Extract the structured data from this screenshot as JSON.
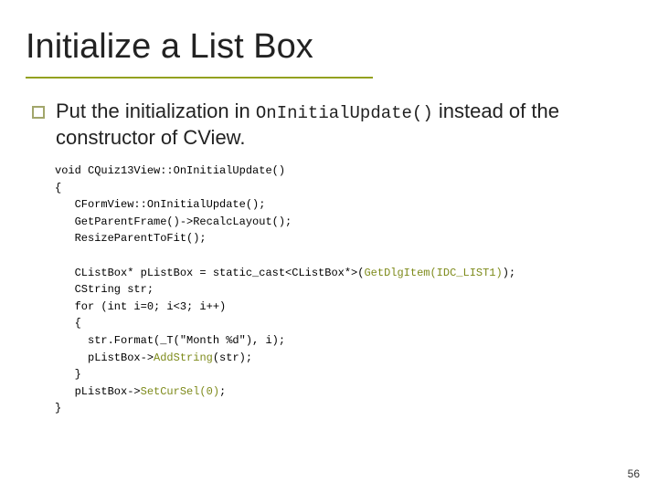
{
  "title": "Initialize a List Box",
  "bullet": {
    "lead": "Put the initialization in ",
    "mono": "OnInitialUpdate()",
    "tail": " instead of the constructor of CView."
  },
  "code": {
    "l1": "void CQuiz13View::OnInitialUpdate()",
    "l2": "{",
    "l3": "   CFormView::OnInitialUpdate();",
    "l4": "   GetParentFrame()->RecalcLayout();",
    "l5": "   ResizeParentToFit();",
    "l6": "",
    "l7a": "   CListBox* pListBox = static_cast<CListBox*>(",
    "l7b": "GetDlgItem(IDC_LIST1)",
    "l7c": ");",
    "l8": "   CString str;",
    "l9": "   for (int i=0; i<3; i++)",
    "l10": "   {",
    "l11": "     str.Format(_T(\"Month %d\"), i);",
    "l12a": "     pListBox->",
    "l12b": "AddString",
    "l12c": "(str);",
    "l13": "   }",
    "l14a": "   pListBox->",
    "l14b": "SetCurSel(0)",
    "l14c": ";",
    "l15": "}"
  },
  "page": "56"
}
